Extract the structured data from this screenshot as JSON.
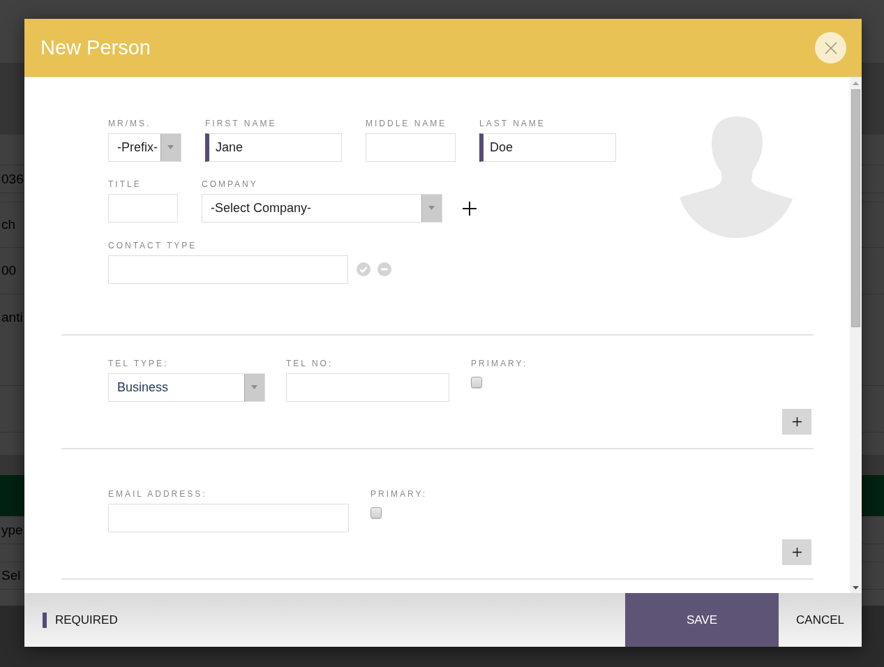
{
  "backdrop": {
    "fragments": [
      "036",
      "ch",
      "00",
      "anti",
      "ype",
      "Sel"
    ]
  },
  "dialog": {
    "title": "New Person"
  },
  "name_row": [
    {
      "kind": "dropdown",
      "label": "MR/MS.",
      "value": "-Prefix-",
      "required": false
    },
    {
      "kind": "text",
      "label": "FIRST NAME",
      "value": "Jane",
      "required": true
    },
    {
      "kind": "text",
      "label": "MIDDLE NAME",
      "required": false
    },
    {
      "kind": "text",
      "label": "LAST NAME",
      "value": "Doe",
      "required": true
    }
  ],
  "company_row": [
    {
      "kind": "text",
      "label": "TITLE",
      "required": false
    },
    {
      "kind": "dropdown",
      "label": "COMPANY",
      "value": "-Select Company-",
      "required": false
    }
  ],
  "contact_type": {
    "label": "CONTACT TYPE"
  },
  "phone": {
    "type_label": "TEL TYPE:",
    "type_value": "Business",
    "number_label": "TEL NO:",
    "primary_label": "PRIMARY:",
    "primary": false
  },
  "email": {
    "address_label": "EMAIL ADDRESS:",
    "primary_label": "PRIMARY:",
    "primary": false
  },
  "footer": {
    "legend": "REQUIRED",
    "buttons": [
      {
        "kind": "primary",
        "label": "SAVE"
      },
      {
        "kind": "plain",
        "label": "CANCEL"
      }
    ]
  }
}
